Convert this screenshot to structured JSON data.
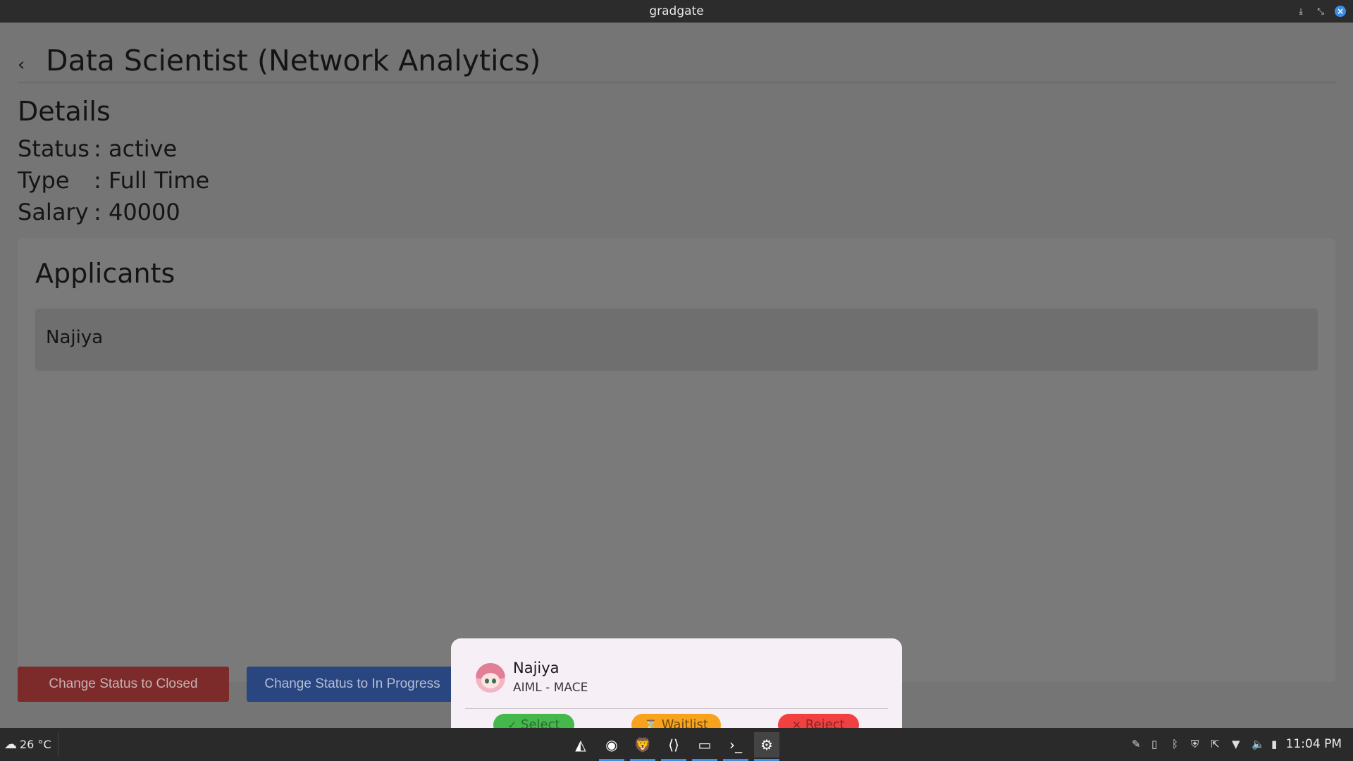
{
  "window": {
    "title": "gradgate"
  },
  "page": {
    "title": "Data Scientist (Network Analytics)",
    "details_heading": "Details",
    "details": [
      {
        "key": "Status",
        "sep": ":",
        "value": "active"
      },
      {
        "key": "Type",
        "sep": ":",
        "value": "Full Time"
      },
      {
        "key": "Salary",
        "sep": ":",
        "value": "40000"
      }
    ],
    "applicants_heading": "Applicants",
    "applicants": [
      {
        "name": "Najiya"
      }
    ],
    "buttons": {
      "close_status": "Change Status to Closed",
      "in_progress_status": "Change Status to In Progress"
    }
  },
  "sheet": {
    "name": "Najiya",
    "subtitle": "AIML - MACE",
    "actions": {
      "select": "Select",
      "waitlist": "Waitlist",
      "reject": "Reject"
    }
  },
  "taskbar": {
    "weather": "26 °C",
    "clock": "11:04 PM",
    "apps": [
      "mountain-app",
      "chrome",
      "brave",
      "vscode",
      "files",
      "terminal",
      "settings"
    ]
  },
  "colors": {
    "select": "#45b84b",
    "waitlist": "#f8a31d",
    "reject": "#f04040",
    "accent": "#3d8ee6"
  }
}
